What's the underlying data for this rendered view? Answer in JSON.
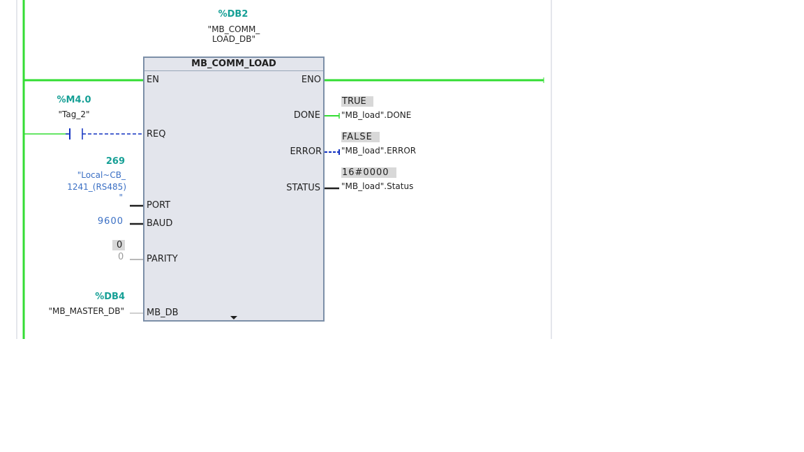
{
  "colors": {
    "power_rail": "#33dd33",
    "signal_true": "#33dd33",
    "signal_blue": "#1030c0",
    "address": "#17a096",
    "constant": "#3a6fc4",
    "block_fill": "#e3e5ec",
    "value_box": "#d8d8d8",
    "divider": "#c8cdd8"
  },
  "instance": {
    "address": "%DB2",
    "name_line1": "\"MB_COMM_",
    "name_line2": "LOAD_DB\""
  },
  "block": {
    "title": "MB_COMM_LOAD",
    "inputs": {
      "en": "EN",
      "req": "REQ",
      "port": "PORT",
      "baud": "BAUD",
      "parity": "PARITY",
      "mb_db": "MB_DB"
    },
    "outputs": {
      "eno": "ENO",
      "done": "DONE",
      "error": "ERROR",
      "status": "STATUS"
    }
  },
  "req_contact": {
    "address": "%M4.0",
    "tag": "\"Tag_2\""
  },
  "port_param": {
    "value": "269",
    "line1": "\"Local~CB_",
    "line2": "1241_(RS485)",
    "line3": "\""
  },
  "baud_param": {
    "value": "9600"
  },
  "parity_param": {
    "monitor": "0",
    "value": "0"
  },
  "mb_db_param": {
    "address": "%DB4",
    "tag": "\"MB_MASTER_DB\""
  },
  "done_out": {
    "monitor": "TRUE",
    "tag": "\"MB_load\".DONE"
  },
  "error_out": {
    "monitor": "FALSE",
    "tag": "\"MB_load\".ERROR"
  },
  "status_out": {
    "monitor": "16#0000",
    "tag": "\"MB_load\".Status"
  }
}
